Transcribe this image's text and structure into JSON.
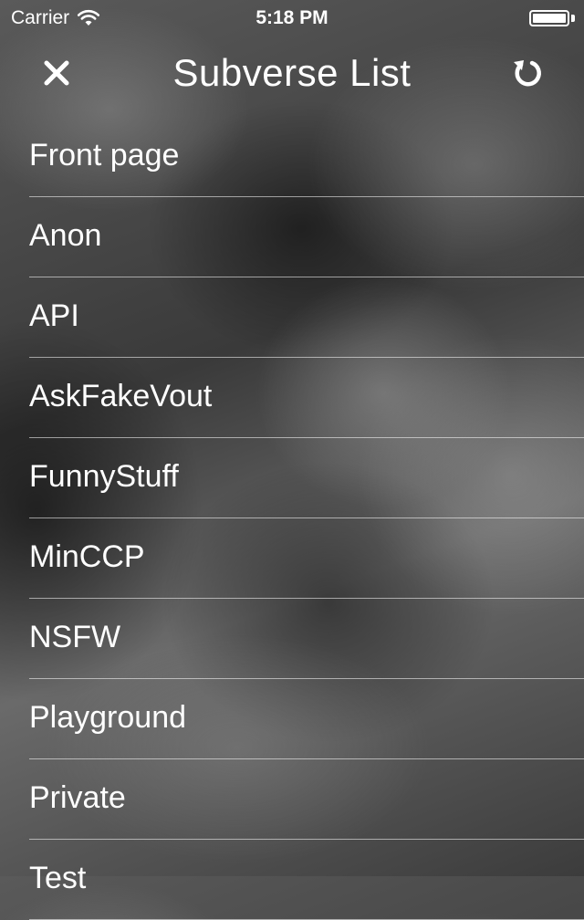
{
  "status_bar": {
    "carrier": "Carrier",
    "time": "5:18 PM"
  },
  "nav_bar": {
    "title": "Subverse List",
    "left_icon": "close-icon",
    "right_icon": "refresh-icon"
  },
  "subverses": [
    {
      "label": "Front page"
    },
    {
      "label": "Anon"
    },
    {
      "label": "API"
    },
    {
      "label": "AskFakeVout"
    },
    {
      "label": "FunnyStuff"
    },
    {
      "label": "MinCCP"
    },
    {
      "label": "NSFW"
    },
    {
      "label": "Playground"
    },
    {
      "label": "Private"
    },
    {
      "label": "Test"
    }
  ]
}
